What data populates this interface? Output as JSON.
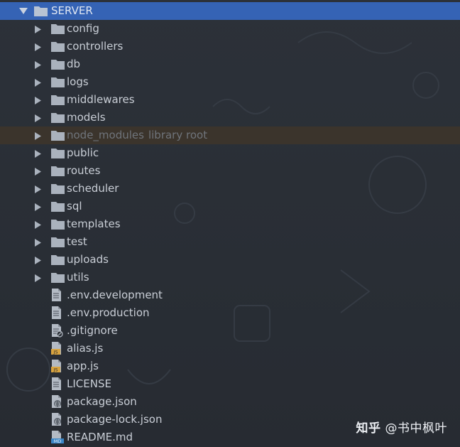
{
  "root": {
    "label": "SERVER",
    "expanded": true
  },
  "folders": [
    {
      "label": "config"
    },
    {
      "label": "controllers"
    },
    {
      "label": "db"
    },
    {
      "label": "logs"
    },
    {
      "label": "middlewares"
    },
    {
      "label": "models"
    },
    {
      "label": "node_modules",
      "hint": "library root",
      "excluded": true
    },
    {
      "label": "public"
    },
    {
      "label": "routes"
    },
    {
      "label": "scheduler"
    },
    {
      "label": "sql"
    },
    {
      "label": "templates"
    },
    {
      "label": "test"
    },
    {
      "label": "uploads"
    },
    {
      "label": "utils"
    }
  ],
  "files": [
    {
      "label": ".env.development",
      "icon": "text-file-icon"
    },
    {
      "label": ".env.production",
      "icon": "text-file-icon"
    },
    {
      "label": ".gitignore",
      "icon": "gitignore-file-icon"
    },
    {
      "label": "alias.js",
      "icon": "js-file-icon"
    },
    {
      "label": "app.js",
      "icon": "js-file-icon"
    },
    {
      "label": "LICENSE",
      "icon": "text-file-icon"
    },
    {
      "label": "package.json",
      "icon": "json-file-icon"
    },
    {
      "label": "package-lock.json",
      "icon": "json-file-icon"
    },
    {
      "label": "README.md",
      "icon": "markdown-file-icon"
    }
  ],
  "watermark": {
    "logo": "知乎",
    "handle": "@书中枫叶"
  },
  "colors": {
    "background": "#2b3037",
    "selected_row": "#3563b5",
    "excluded_row": "#3b342c",
    "text": "#c9ced6",
    "muted_text": "#6f747b",
    "js_badge": "#d9a441",
    "md_badge": "#3a87c8"
  }
}
